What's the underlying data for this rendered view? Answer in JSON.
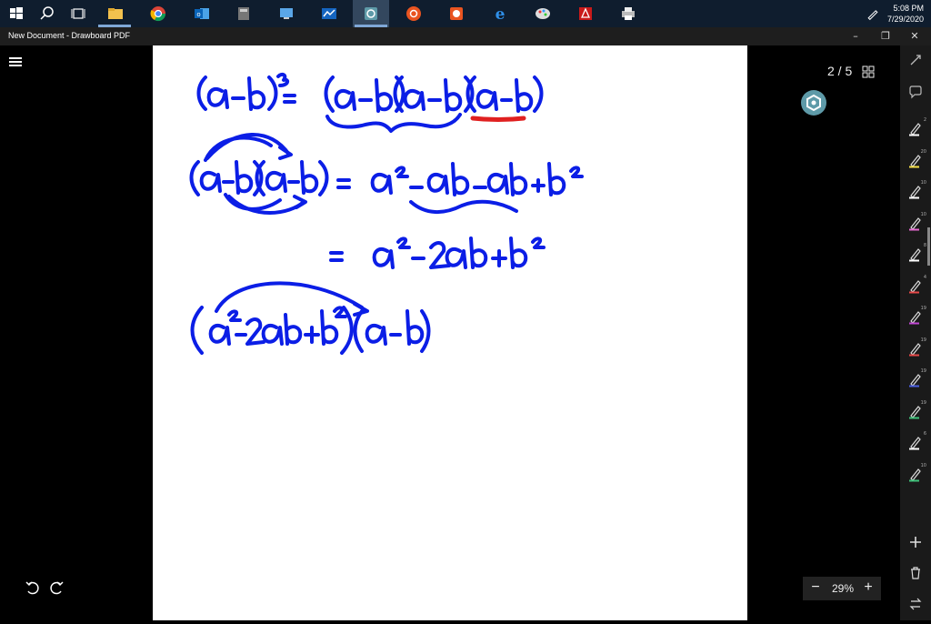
{
  "taskbar": {
    "clock_time": "5:08 PM",
    "clock_date": "7/29/2020"
  },
  "window": {
    "title": "New Document - Drawboard PDF"
  },
  "viewer": {
    "page_indicator": "2 / 5",
    "zoom_level": "29%",
    "zoom_minus": "−",
    "zoom_plus": "+"
  },
  "sidebar": {
    "tools": [
      {
        "name": "pen",
        "size": "2",
        "color": "#ffffff"
      },
      {
        "name": "highlighter",
        "size": "20",
        "color": "#f5e04a"
      },
      {
        "name": "pen",
        "size": "10",
        "color": "#ffffff"
      },
      {
        "name": "pen",
        "size": "10",
        "color": "#e66ad0"
      },
      {
        "name": "pen",
        "size": "8",
        "color": "#ffffff"
      },
      {
        "name": "pen",
        "size": "4",
        "color": "#e64848"
      },
      {
        "name": "pen",
        "size": "19",
        "color": "#c146d4"
      },
      {
        "name": "pen",
        "size": "19",
        "color": "#e64848"
      },
      {
        "name": "pen",
        "size": "19",
        "color": "#4b5fe0"
      },
      {
        "name": "pen",
        "size": "19",
        "color": "#3fc27a"
      },
      {
        "name": "pen",
        "size": "6",
        "color": "#ffffff"
      },
      {
        "name": "pen",
        "size": "10",
        "color": "#3fc27a"
      }
    ]
  },
  "colors": {
    "ink_blue": "#0b1ee6",
    "ink_red": "#e02020"
  }
}
